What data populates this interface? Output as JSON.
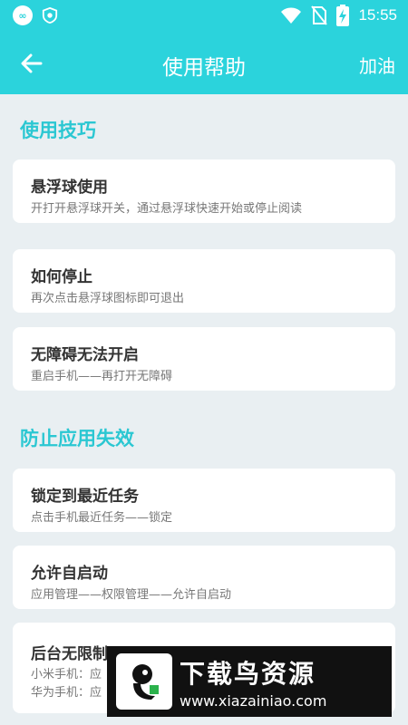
{
  "status_bar": {
    "badge": "∞",
    "time": "15:55"
  },
  "appbar": {
    "title": "使用帮助",
    "action_label": "加油"
  },
  "sections": [
    {
      "title": "使用技巧",
      "items": [
        {
          "title": "悬浮球使用",
          "desc": "开打开悬浮球开关，通过悬浮球快速开始或停止阅读"
        },
        {
          "title": "如何停止",
          "desc": "再次点击悬浮球图标即可退出"
        },
        {
          "title": "无障碍无法开启",
          "desc": "重启手机——再打开无障碍"
        }
      ]
    },
    {
      "title": "防止应用失效",
      "items": [
        {
          "title": "锁定到最近任务",
          "desc": "点击手机最近任务——锁定"
        },
        {
          "title": "允许自启动",
          "desc": "应用管理——权限管理——允许自启动"
        },
        {
          "title": "后台无限制",
          "desc": "小米手机：应",
          "desc2": "华为手机：应"
        }
      ]
    }
  ],
  "watermark": {
    "brand": "下载鸟资源",
    "url": "www.xiazainiao.com"
  },
  "colors": {
    "accent": "#2bd3dc",
    "section_title": "#2bc7d2",
    "background": "#e9eff2"
  }
}
